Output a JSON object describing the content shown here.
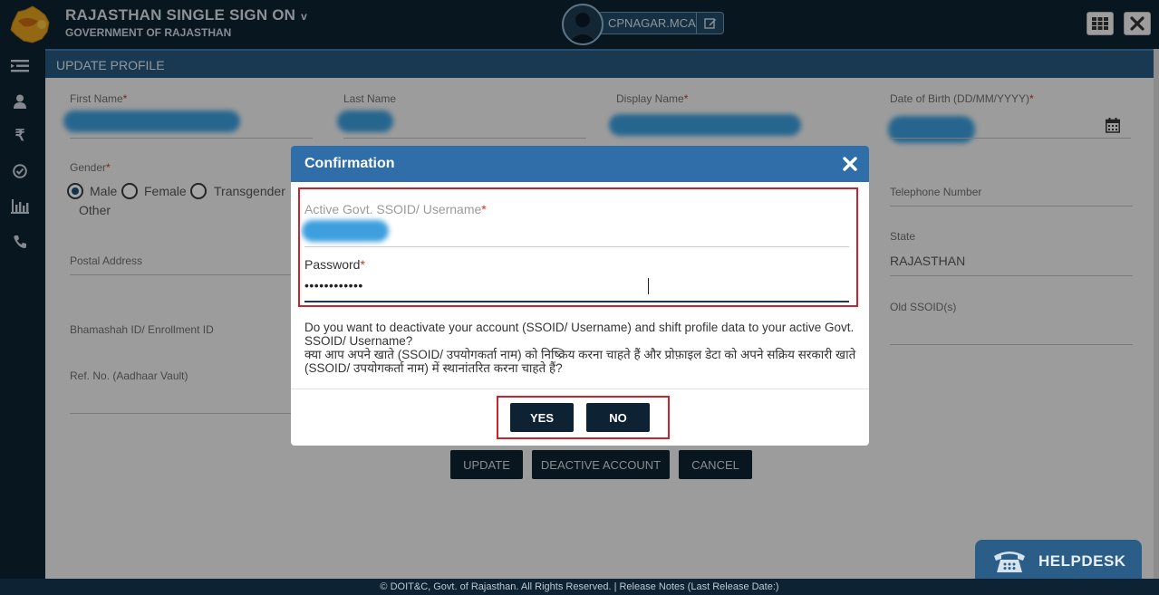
{
  "header": {
    "title": "RAJASTHAN SINGLE SIGN ON",
    "title_chevron": "v",
    "subtitle": "GOVERNMENT OF RAJASTHAN",
    "username": "CPNAGAR.MCA"
  },
  "page": {
    "title": "UPDATE PROFILE"
  },
  "form": {
    "first_name_label": "First Name",
    "last_name_label": "Last Name",
    "display_name_label": "Display Name",
    "dob_label": "Date of Birth (DD/MM/YYYY)",
    "gender_label": "Gender",
    "gender_options": [
      "Male",
      "Female",
      "Transgender",
      "Other"
    ],
    "gender_selected": "Male",
    "telephone_label": "Telephone Number",
    "postal_label": "Postal Address",
    "state_label": "State",
    "state_value": "RAJASTHAN",
    "bhamashah_label": "Bhamashah ID/ Enrollment ID",
    "old_ssoid_label": "Old SSOID(s)",
    "refno_label": "Ref. No. (Aadhaar Vault)",
    "required_mark": "*"
  },
  "actions": {
    "update": "UPDATE",
    "deactivate": "DEACTIVE ACCOUNT",
    "cancel": "CANCEL"
  },
  "modal": {
    "title": "Confirmation",
    "ssoid_label": "Active Govt. SSOID/ Username",
    "password_label": "Password",
    "password_value": "••••••••••••",
    "message_en": "Do you want to deactivate your account (SSOID/ Username) and shift profile data to your active Govt. SSOID/ Username?",
    "message_hi": "क्या आप अपने खाते (SSOID/ उपयोगकर्ता नाम) को निष्क्रिय करना चाहते हैं और प्रोफ़ाइल डेटा को अपने सक्रिय सरकारी खाते (SSOID/ उपयोगकर्ता नाम) में स्थानांतरित करना चाहते हैं?",
    "yes": "YES",
    "no": "NO"
  },
  "footer": {
    "text": "© DOIT&C, Govt. of Rajasthan. All Rights Reserved.  |  Release Notes (Last Release Date:)"
  },
  "helpdesk": {
    "label": "HELPDESK"
  },
  "colors": {
    "header_bg": "#0d2232",
    "modal_header": "#2f6ea9",
    "highlight_red": "#c9242b",
    "button_dark": "#0d2232"
  }
}
